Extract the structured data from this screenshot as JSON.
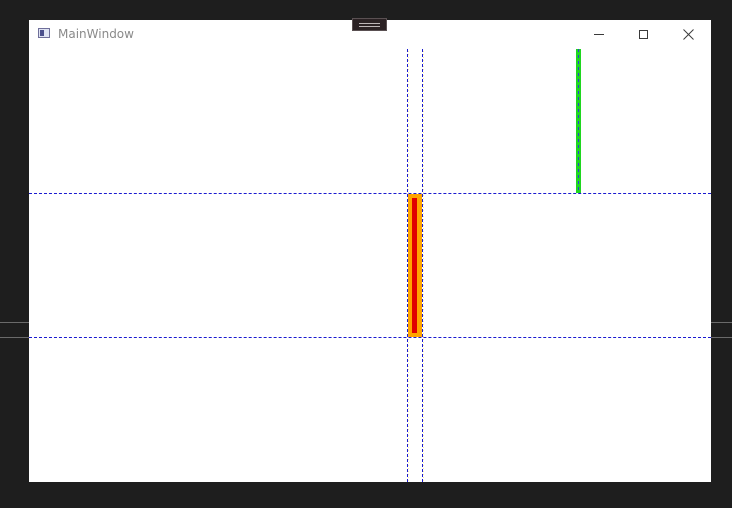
{
  "window": {
    "title": "MainWindow"
  },
  "icons": {
    "app": "app-window-icon",
    "minimize": "minimize-icon",
    "maximize": "maximize-icon",
    "close": "close-icon"
  },
  "colors": {
    "desktop_background": "#1e1e1e",
    "window_background": "#ffffff",
    "guide_line": "#1a1ad0",
    "green_marker": "#1fd61f",
    "orange_marker": "#ffa500",
    "red_marker": "#e00000"
  }
}
